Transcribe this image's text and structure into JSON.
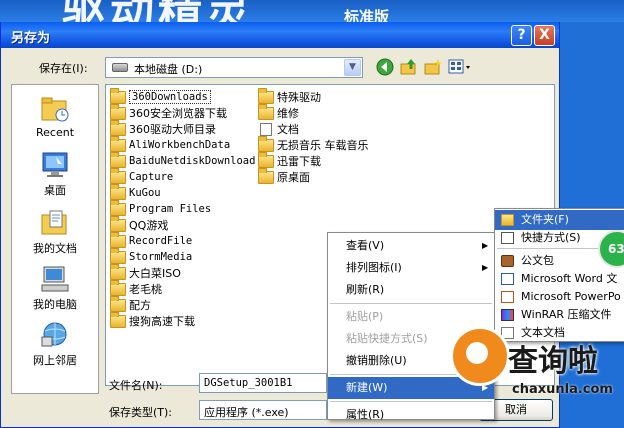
{
  "background": {
    "banner_big": "驱动精灵",
    "banner_small": "标准版"
  },
  "dialog": {
    "title": "另存为",
    "help_label": "?",
    "close_label": "X"
  },
  "save_in": {
    "label": "保存在(I):",
    "value": "本地磁盘 (D:)"
  },
  "places": [
    {
      "label": "Recent",
      "icon": "recent-icon"
    },
    {
      "label": "桌面",
      "icon": "desktop-icon"
    },
    {
      "label": "我的文档",
      "icon": "my-documents-icon"
    },
    {
      "label": "我的电脑",
      "icon": "my-computer-icon"
    },
    {
      "label": "网上邻居",
      "icon": "network-icon"
    }
  ],
  "files_col1": [
    {
      "name": "360Downloads",
      "type": "folder",
      "mono": true
    },
    {
      "name": "360安全浏览器下载",
      "type": "folder"
    },
    {
      "name": "360驱动大师目录",
      "type": "folder"
    },
    {
      "name": "AliWorkbenchData",
      "type": "folder",
      "mono": true
    },
    {
      "name": "BaiduNetdiskDownload",
      "type": "folder",
      "mono": true
    },
    {
      "name": "Capture",
      "type": "folder",
      "mono": true
    },
    {
      "name": "KuGou",
      "type": "folder",
      "mono": true
    },
    {
      "name": "Program Files",
      "type": "folder",
      "mono": true
    },
    {
      "name": "QQ游戏",
      "type": "folder"
    },
    {
      "name": "RecordFile",
      "type": "folder",
      "mono": true
    },
    {
      "name": "StormMedia",
      "type": "folder",
      "mono": true
    },
    {
      "name": "大白菜ISO",
      "type": "folder"
    },
    {
      "name": "老毛桃",
      "type": "folder"
    },
    {
      "name": "配方",
      "type": "folder"
    },
    {
      "name": "搜狗高速下载",
      "type": "folder"
    }
  ],
  "files_col2": [
    {
      "name": "特殊驱动",
      "type": "folder"
    },
    {
      "name": "维修",
      "type": "folder"
    },
    {
      "name": "文档",
      "type": "document"
    },
    {
      "name": "无损音乐 车载音乐",
      "type": "folder"
    },
    {
      "name": "迅雷下载",
      "type": "folder"
    },
    {
      "name": "原桌面",
      "type": "folder"
    }
  ],
  "filename": {
    "label": "文件名(N):",
    "value": "DGSetup_3001B1"
  },
  "filetype": {
    "label": "保存类型(T):",
    "value": "应用程序 (*.exe)"
  },
  "cancel_label": "取消",
  "context_menu": [
    {
      "label": "查看(V)",
      "submenu": true,
      "disabled": false
    },
    {
      "label": "排列图标(I)",
      "submenu": true,
      "disabled": false
    },
    {
      "label": "刷新(R)",
      "submenu": false,
      "disabled": false
    },
    {
      "label": "粘贴(P)",
      "submenu": false,
      "disabled": true
    },
    {
      "label": "粘贴快捷方式(S)",
      "submenu": false,
      "disabled": true
    },
    {
      "label": "撤销删除(U)",
      "submenu": false,
      "disabled": false,
      "shortcut": "C"
    },
    {
      "label": "新建(W)",
      "submenu": true,
      "disabled": false,
      "highlighted": true
    },
    {
      "label": "属性(R)",
      "submenu": false,
      "disabled": false
    }
  ],
  "new_submenu": [
    {
      "label": "文件夹(F)",
      "icon": "folder-icon",
      "highlighted": true
    },
    {
      "label": "快捷方式(S)",
      "icon": "shortcut-icon"
    },
    {
      "label": "公文包",
      "icon": "briefcase-icon"
    },
    {
      "label": "Microsoft Word 文",
      "icon": "word-icon"
    },
    {
      "label": "Microsoft PowerPo",
      "icon": "powerpoint-icon"
    },
    {
      "label": "WinRAR 压缩文件",
      "icon": "winrar-icon"
    },
    {
      "label": "文本文档",
      "icon": "text-doc-icon"
    }
  ],
  "badge_text": "63",
  "watermark": {
    "brand": "查询啦",
    "url": "chaxunla.com"
  },
  "colors": {
    "titlebar": "#0a5ef0",
    "highlight": "#316ac5",
    "dialog_bg": "#ece9d8"
  }
}
